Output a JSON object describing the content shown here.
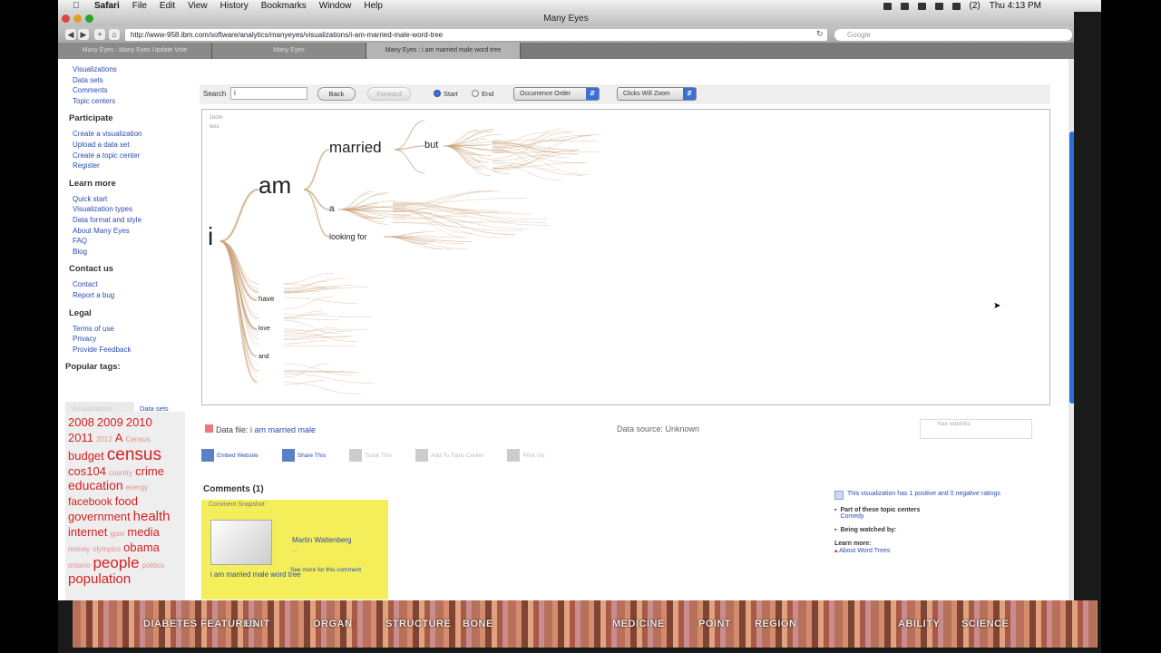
{
  "menubar": {
    "apple": "",
    "app_name": "Safari",
    "items": [
      "File",
      "Edit",
      "View",
      "History",
      "Bookmarks",
      "Window",
      "Help"
    ],
    "clock": "Thu 4:13 PM",
    "battery": "(2)"
  },
  "window": {
    "title": "Many Eyes",
    "url": "http://www-958.ibm.com/software/analytics/manyeyes/visualizations/i-am-married-male-word-tree",
    "search_placeholder": "Google",
    "tabs": [
      "Many Eyes : Many Eyes Update Vote",
      "Many Eyes",
      "Many Eyes : i am married male word tree"
    ]
  },
  "sidebar": {
    "top_links": [
      "Visualizations",
      "Data sets",
      "Comments",
      "Topic centers"
    ],
    "sections": [
      {
        "title": "Participate",
        "links": [
          "Create a visualization",
          "Upload a data set",
          "Create a topic center",
          "Register"
        ]
      },
      {
        "title": "Learn more",
        "links": [
          "Quick start",
          "Visualization types",
          "Data format and style",
          "About Many Eyes",
          "FAQ",
          "Blog"
        ]
      },
      {
        "title": "Contact us",
        "links": [
          "Contact",
          "Report a bug"
        ]
      },
      {
        "title": "Legal",
        "links": [
          "Terms of use",
          "Privacy",
          "Provide Feedback"
        ]
      }
    ],
    "popular_tags_title": "Popular tags:",
    "tag_tabs": [
      "Visualizations",
      "Data sets"
    ],
    "tags": [
      {
        "t": "2008",
        "s": 13
      },
      {
        "t": "2009",
        "s": 13
      },
      {
        "t": "2010",
        "s": 13
      },
      {
        "t": "2011",
        "s": 13
      },
      {
        "t": "2012",
        "s": 8,
        "faint": true
      },
      {
        "t": "A",
        "s": 13
      },
      {
        "t": "Census",
        "s": 8,
        "faint": true
      },
      {
        "t": "budget",
        "s": 13
      },
      {
        "t": "census",
        "s": 19
      },
      {
        "t": "cos104",
        "s": 13
      },
      {
        "t": "country",
        "s": 8,
        "faint": true
      },
      {
        "t": "crime",
        "s": 13
      },
      {
        "t": "education",
        "s": 14
      },
      {
        "t": "energy",
        "s": 8,
        "faint": true
      },
      {
        "t": "facebook",
        "s": 12
      },
      {
        "t": "food",
        "s": 13
      },
      {
        "t": "government",
        "s": 13
      },
      {
        "t": "health",
        "s": 15
      },
      {
        "t": "internet",
        "s": 13
      },
      {
        "t": "jgsw",
        "s": 8,
        "faint": true
      },
      {
        "t": "media",
        "s": 13
      },
      {
        "t": "money",
        "s": 8,
        "faint": true
      },
      {
        "t": "olympics",
        "s": 8,
        "faint": true
      },
      {
        "t": "obama",
        "s": 13
      },
      {
        "t": "ontario",
        "s": 8,
        "faint": true
      },
      {
        "t": "people",
        "s": 17
      },
      {
        "t": "politics",
        "s": 8,
        "faint": true
      },
      {
        "t": "population",
        "s": 15
      }
    ]
  },
  "viz_controls": {
    "search_label": "Search",
    "search_value": "i",
    "back_label": "Back",
    "forward_label": "Forward",
    "radio_start": "Start",
    "radio_end": "End",
    "select_order": "Occurrence Order",
    "select_zoom": "Clicks Will Zoom"
  },
  "tree": {
    "top_left": [
      "zoom",
      "less"
    ],
    "words": [
      "i",
      "am",
      "married",
      "but",
      "a",
      "looking for",
      "have",
      "love",
      "and"
    ]
  },
  "data_info": {
    "data_file_label": "Data file:",
    "data_file_link": "i am married male",
    "data_source": "Data source: Unknown",
    "watchlist": "Your watchlist",
    "shares": [
      "Embed Website",
      "Share This",
      "Track This",
      "Add To Topic Center",
      "Print Vis"
    ]
  },
  "comments": {
    "title": "Comments (1)",
    "card_header": "Comment Snapshot",
    "caption": "i am married male word tree",
    "author": "Martin Wattenberg",
    "body": "...",
    "see": "See more for this comment"
  },
  "right_info": {
    "rating": "This visualization has 1 positive and 0 negative ratings",
    "topic_title": "Part of these topic centers",
    "topic_link": "Comedy",
    "watched_title": "Being watched by:",
    "learn_title": "Learn more:",
    "learn_link": "About Word Trees"
  },
  "dock_labels": [
    "DIABETES FEATURES",
    "UNIT",
    "ORGAN",
    "STRUCTURE",
    "BONE",
    "MEDICINE",
    "POINT",
    "REGION",
    "ABILITY",
    "SCIENCE"
  ]
}
